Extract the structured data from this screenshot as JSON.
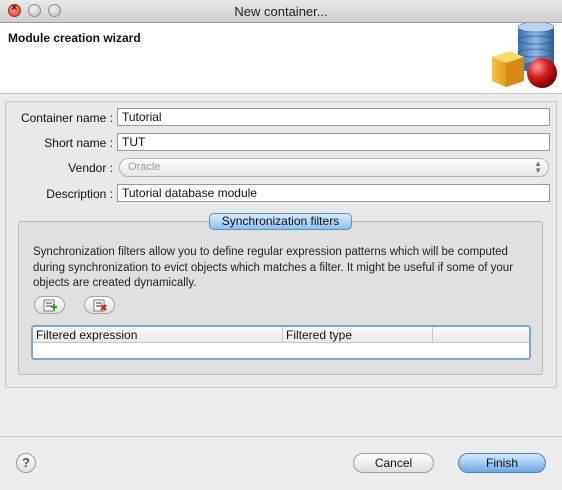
{
  "window": {
    "title": "New container..."
  },
  "header": {
    "title": "Module creation wizard",
    "icon": "database-cube-icon"
  },
  "form": {
    "container_name": {
      "label": "Container name :",
      "value": "Tutorial"
    },
    "short_name": {
      "label": "Short name :",
      "value": "TUT"
    },
    "vendor": {
      "label": "Vendor :",
      "value": "Oracle"
    },
    "description": {
      "label": "Description :",
      "value": "Tutorial database module"
    }
  },
  "sync": {
    "title": "Synchronization filters",
    "text": "Synchronization filters allow you to define regular expression patterns which will be computed during synchronization to evict objects which matches a filter. It might be useful if some of your objects are created dynamically.",
    "add_icon": "add-filter-icon",
    "remove_icon": "remove-filter-icon",
    "columns": [
      "Filtered expression",
      "Filtered type",
      ""
    ]
  },
  "footer": {
    "cancel": "Cancel",
    "finish": "Finish",
    "help": "?"
  },
  "colors": {
    "accent": "#6fa8e6",
    "close": "#d53a2a"
  }
}
